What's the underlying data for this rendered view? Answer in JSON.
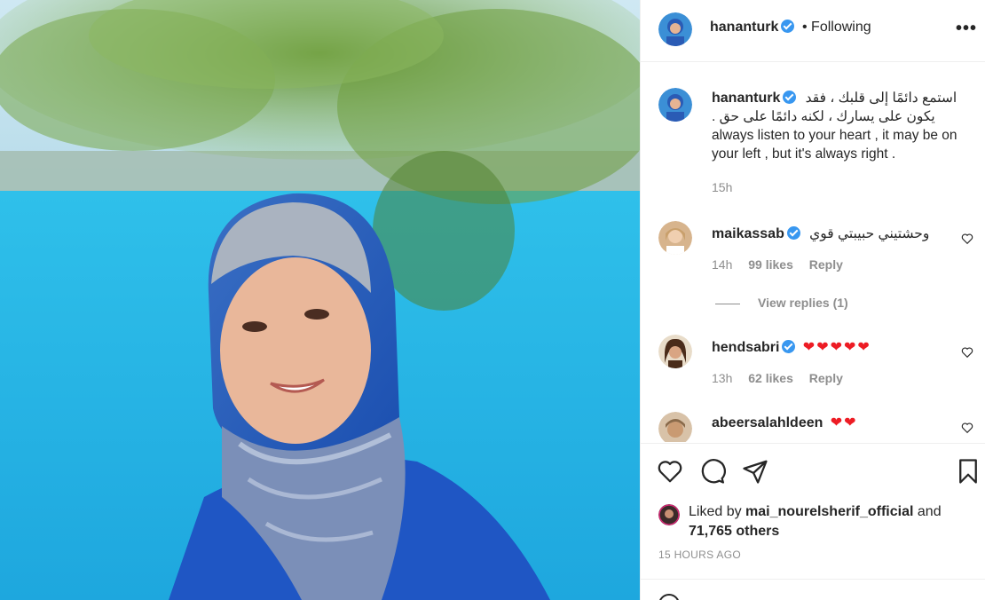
{
  "header": {
    "username": "hananturk",
    "following_label": "• Following"
  },
  "caption": {
    "username": "hananturk",
    "text_ar_line1": "استمع دائمًا إلى قلبك ، فقد",
    "text_ar_line2": "يكون على يسارك ، لكنه دائمًا على حق .",
    "text_en": "always listen to your heart , it may be on your left , but it's always right .",
    "time": "15h"
  },
  "comments": [
    {
      "username": "maikassab",
      "text": "وحشتيني حبيبتي قوي",
      "time": "14h",
      "likes": "99 likes",
      "reply": "Reply",
      "view_replies": "View replies (1)"
    },
    {
      "username": "hendsabri",
      "text": "❤❤❤❤❤",
      "time": "13h",
      "likes": "62 likes",
      "reply": "Reply"
    },
    {
      "username": "abeersalahldeen",
      "text": "❤❤"
    }
  ],
  "liked_by": {
    "prefix": "Liked by",
    "user": "mai_nourelsherif_official",
    "and": "and",
    "others": "71,765 others"
  },
  "time_ago": "15 HOURS AGO",
  "icons": {
    "more": "more-options-icon",
    "like": "heart-icon",
    "comment": "comment-icon",
    "share": "share-icon",
    "save": "bookmark-icon"
  },
  "colors": {
    "verified": "#3897f0",
    "heart_red": "#ed1c24",
    "muted": "#8e8e8e"
  }
}
